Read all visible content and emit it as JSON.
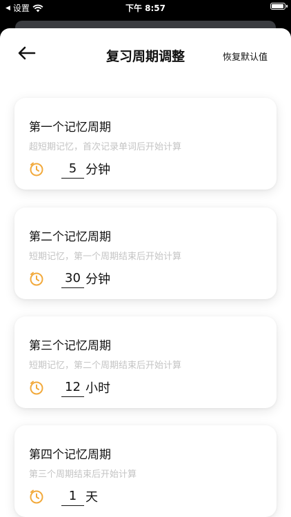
{
  "status_bar": {
    "carrier": "设置",
    "time": "下午 8:57"
  },
  "nav": {
    "title": "复习周期调整",
    "reset_label": "恢复默认值"
  },
  "theme": {
    "accent": "#F2A93B"
  },
  "cycles": [
    {
      "title": "第一个记忆周期",
      "desc": "超短期记忆，首次记录单词后开始计算",
      "value": "5",
      "unit": "分钟"
    },
    {
      "title": "第二个记忆周期",
      "desc": "短期记忆，第一个周期结束后开始计算",
      "value": "30",
      "unit": "分钟"
    },
    {
      "title": "第三个记忆周期",
      "desc": "短期记忆，第二个周期结束后开始计算",
      "value": "12",
      "unit": "小时"
    },
    {
      "title": "第四个记忆周期",
      "desc": "第三个周期结束后开始计算",
      "value": "1",
      "unit": "天"
    }
  ]
}
